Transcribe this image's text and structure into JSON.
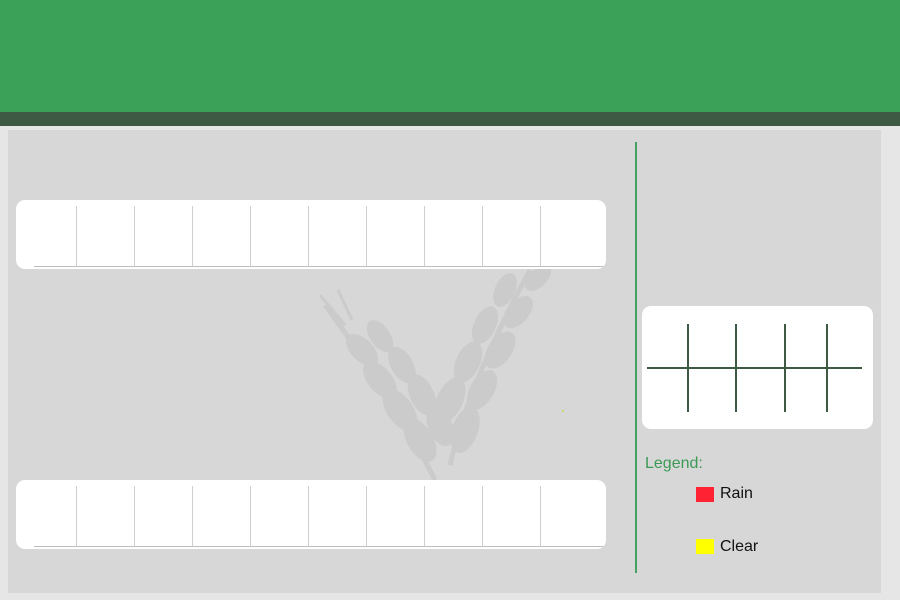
{
  "legend": {
    "title": "Legend:",
    "items": [
      {
        "label": "Rain",
        "color": "#ff2233"
      },
      {
        "label": "Clear",
        "color": "#ffff00"
      }
    ]
  },
  "colors": {
    "header": "#3ba158",
    "header_stripe": "#3f5a44",
    "panel": "#d7d7d7",
    "accent": "#46a061"
  },
  "icons": {
    "background": "wheat-watermark-icon"
  }
}
